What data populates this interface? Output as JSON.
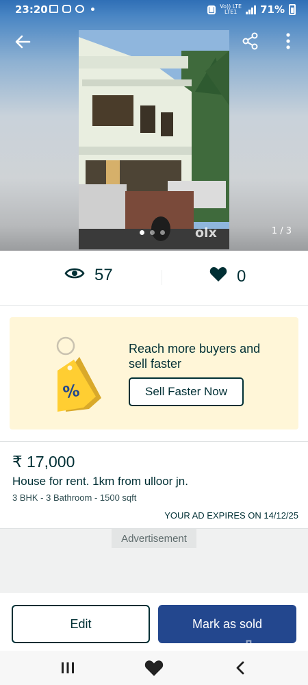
{
  "status_bar": {
    "time": "23:20",
    "network_top": "Vo)) LTE",
    "network_bottom": "LTE1",
    "battery": "71%"
  },
  "gallery": {
    "counter": "1 / 3",
    "image_count": 3,
    "active_index": 0,
    "watermark": "olx",
    "icons": {
      "back": "back-arrow-icon",
      "share": "share-icon",
      "more": "more-vert-icon"
    }
  },
  "stats": {
    "views": "57",
    "likes": "0",
    "icons": {
      "views": "eye-icon",
      "likes": "heart-icon"
    }
  },
  "promo": {
    "title": "Reach more buyers and sell faster",
    "button_label": "Sell Faster Now",
    "icon": "percent-tag-icon",
    "tag_glyph": "%",
    "background": "#fff6d8",
    "tag_color": "#ffce32"
  },
  "listing": {
    "price": "₹ 17,000",
    "title": "House for rent. 1km from ulloor jn.",
    "meta": "3 BHK - 3 Bathroom - 1500 sqft",
    "expiry": "YOUR AD EXPIRES ON 14/12/25"
  },
  "advertisement": {
    "label": "Advertisement"
  },
  "actions": {
    "edit_label": "Edit",
    "sold_label": "Mark as sold",
    "primary_color": "#23478e",
    "watermark": "olx"
  },
  "navbar": {
    "icons": [
      "recent-apps-icon",
      "home-heart-icon",
      "back-chevron-icon"
    ]
  }
}
